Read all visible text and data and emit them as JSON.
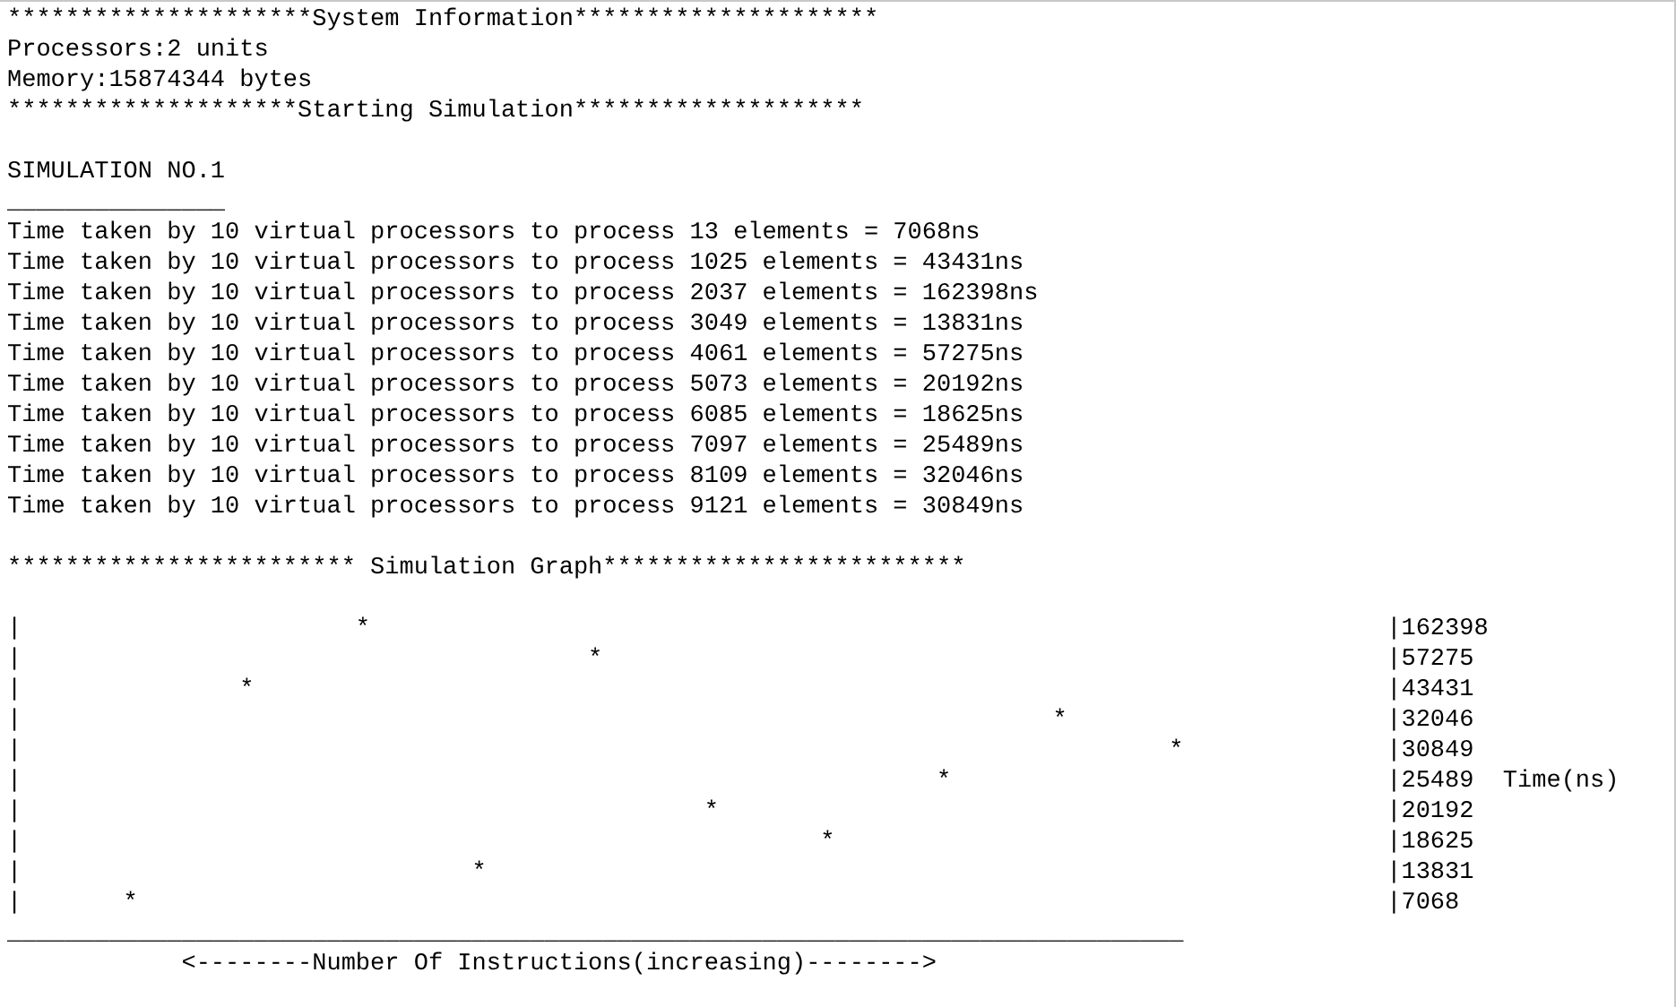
{
  "system_info": {
    "header": "*********************System Information*********************",
    "processors": "Processors:2 units",
    "memory": "Memory:15874344 bytes"
  },
  "simulation": {
    "header": "********************Starting Simulation********************",
    "title": "SIMULATION NO.1",
    "rule": "_______________",
    "results": [
      "Time taken by 10 virtual processors to process 13 elements = 7068ns",
      "Time taken by 10 virtual processors to process 1025 elements = 43431ns",
      "Time taken by 10 virtual processors to process 2037 elements = 162398ns",
      "Time taken by 10 virtual processors to process 3049 elements = 13831ns",
      "Time taken by 10 virtual processors to process 4061 elements = 57275ns",
      "Time taken by 10 virtual processors to process 5073 elements = 20192ns",
      "Time taken by 10 virtual processors to process 6085 elements = 18625ns",
      "Time taken by 10 virtual processors to process 7097 elements = 25489ns",
      "Time taken by 10 virtual processors to process 8109 elements = 32046ns",
      "Time taken by 10 virtual processors to process 9121 elements = 30849ns"
    ]
  },
  "graph": {
    "header": "************************ Simulation Graph*************************",
    "rows": [
      {
        "plot": "|                       *",
        "value": "|162398"
      },
      {
        "plot": "|                                       *",
        "value": "|57275"
      },
      {
        "plot": "|               *",
        "value": "|43431"
      },
      {
        "plot": "|                                                                       *",
        "value": "|32046"
      },
      {
        "plot": "|                                                                               *",
        "value": "|30849"
      },
      {
        "plot": "|                                                               *",
        "value": "|25489",
        "note": "Time(ns)"
      },
      {
        "plot": "|                                               *",
        "value": "|20192"
      },
      {
        "plot": "|                                                       *",
        "value": "|18625"
      },
      {
        "plot": "|                               *",
        "value": "|13831"
      },
      {
        "plot": "|       *",
        "value": "|7068"
      }
    ],
    "rule": "_________________________________________________________________________________",
    "x_label": "            <--------Number Of Instructions(increasing)-------->"
  }
}
